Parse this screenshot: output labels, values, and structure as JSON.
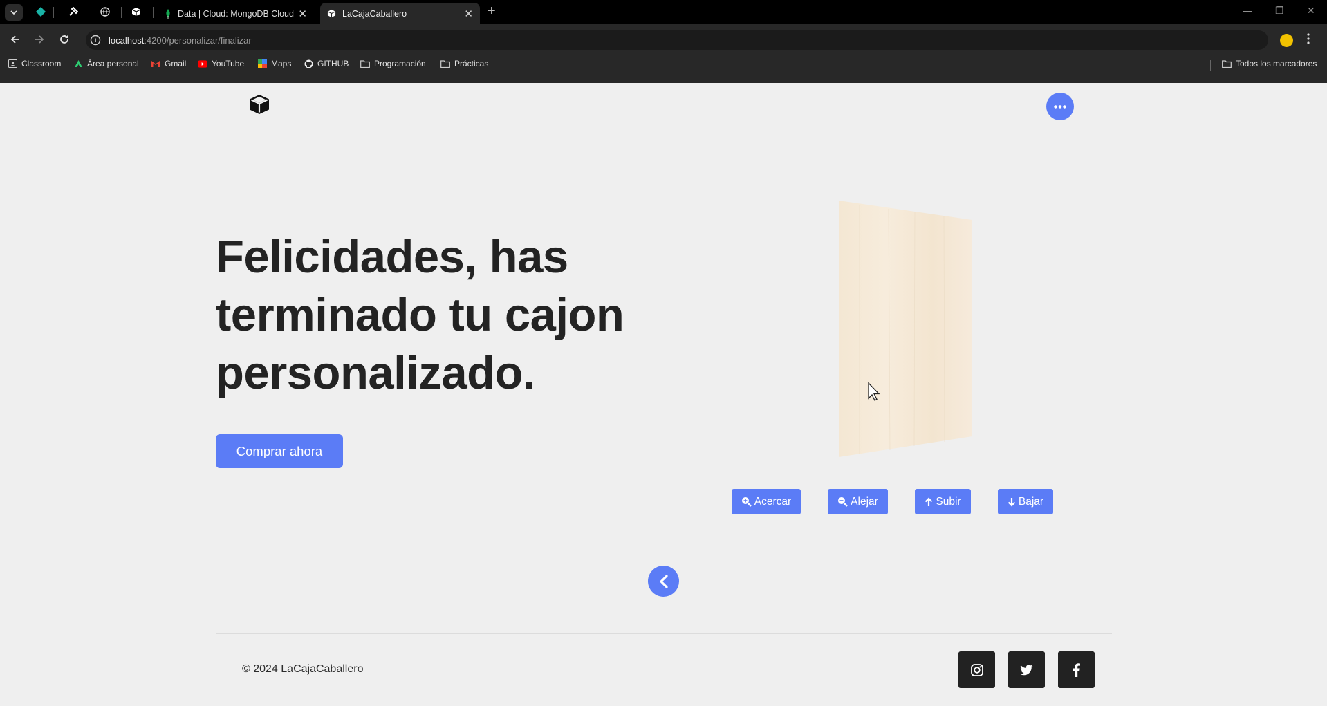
{
  "browser": {
    "tabs": [
      {
        "title": "Data | Cloud: MongoDB Cloud",
        "icon": "mongodb-leaf-icon"
      },
      {
        "title": "LaCajaCaballero",
        "icon": "cube-icon"
      }
    ],
    "url_host": "localhost",
    "url_path": ":4200/personalizar/finalizar",
    "bookmarks": [
      {
        "label": "Classroom",
        "icon": "classroom-icon"
      },
      {
        "label": "Área personal",
        "icon": "moodle-icon"
      },
      {
        "label": "Gmail",
        "icon": "gmail-icon"
      },
      {
        "label": "YouTube",
        "icon": "youtube-icon"
      },
      {
        "label": "Maps",
        "icon": "maps-icon"
      },
      {
        "label": "GITHUB",
        "icon": "github-icon"
      },
      {
        "label": "Programación",
        "icon": "folder-icon"
      },
      {
        "label": "Prácticas",
        "icon": "folder-icon"
      }
    ],
    "all_bookmarks": "Todos los marcadores"
  },
  "hero": {
    "title": "Felicidades, has terminado tu cajon personalizado.",
    "buy_label": "Comprar ahora"
  },
  "viewer_controls": {
    "zoom_in": "Acercar",
    "zoom_out": "Alejar",
    "up": "Subir",
    "down": "Bajar"
  },
  "footer": {
    "copyright": "© 2024 LaCajaCaballero",
    "social": [
      "instagram-icon",
      "twitter-icon",
      "facebook-icon"
    ]
  },
  "colors": {
    "accent": "#5b7cf6",
    "background": "#efefef",
    "text": "#232323",
    "wood": "#f5e9d6"
  }
}
